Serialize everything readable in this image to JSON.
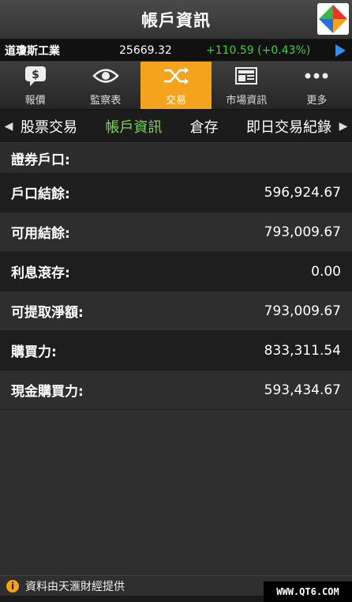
{
  "header": {
    "title": "帳戶資訊"
  },
  "ticker": {
    "name": "道瓊斯工業",
    "price": "25669.32",
    "change": "+110.59 (+0.43%)"
  },
  "tabs": [
    {
      "label": "報價",
      "icon": "quote-icon"
    },
    {
      "label": "監察表",
      "icon": "eye-icon"
    },
    {
      "label": "交易",
      "icon": "shuffle-icon"
    },
    {
      "label": "市場資訊",
      "icon": "news-icon"
    },
    {
      "label": "更多",
      "icon": "more-icon"
    }
  ],
  "subnav": {
    "left_arrow": "◀",
    "right_arrow": "▶",
    "items": [
      "股票交易",
      "帳戶資訊",
      "倉存",
      "即日交易紀錄"
    ]
  },
  "section": {
    "title": "證券戶口:"
  },
  "rows": [
    {
      "label": "戶口結餘:",
      "value": "596,924.67"
    },
    {
      "label": "可用結餘:",
      "value": "793,009.67"
    },
    {
      "label": "利息滾存:",
      "value": "0.00"
    },
    {
      "label": "可提取淨額:",
      "value": "793,009.67"
    },
    {
      "label": "購買力:",
      "value": "833,311.54"
    },
    {
      "label": "現金購買力:",
      "value": "593,434.67"
    }
  ],
  "footer": {
    "info_glyph": "i",
    "text": "資料由天滙財經提供"
  },
  "watermark": "WWW.QT6.COM",
  "colors": {
    "accent": "#f5a21c",
    "positive": "#3fd13f",
    "active_subnav": "#7fd65a"
  }
}
